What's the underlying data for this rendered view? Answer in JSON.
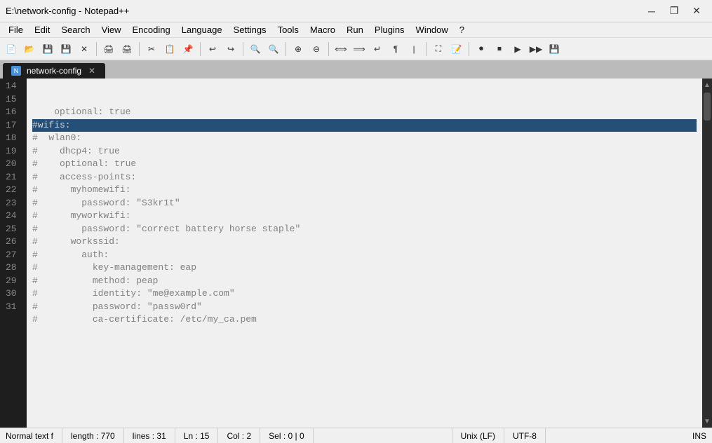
{
  "titleBar": {
    "title": "E:\\network-config - Notepad++",
    "minimizeLabel": "─",
    "restoreLabel": "❐",
    "closeLabel": "✕"
  },
  "menuBar": {
    "items": [
      "File",
      "Edit",
      "Search",
      "View",
      "Encoding",
      "Language",
      "Settings",
      "Tools",
      "Macro",
      "Run",
      "Plugins",
      "Window",
      "?"
    ]
  },
  "tab": {
    "name": "network-config",
    "closeLabel": "✕"
  },
  "codeLines": [
    {
      "num": "14",
      "text": "    optional: true",
      "selected": false
    },
    {
      "num": "15",
      "text": "#wifis:",
      "selected": true
    },
    {
      "num": "16",
      "text": "#  wlan0:",
      "selected": false
    },
    {
      "num": "17",
      "text": "#    dhcp4: true",
      "selected": false
    },
    {
      "num": "18",
      "text": "#    optional: true",
      "selected": false
    },
    {
      "num": "19",
      "text": "#    access-points:",
      "selected": false
    },
    {
      "num": "20",
      "text": "#      myhomewifi:",
      "selected": false
    },
    {
      "num": "21",
      "text": "#        password: \"S3kr1t\"",
      "selected": false
    },
    {
      "num": "22",
      "text": "#      myworkwifi:",
      "selected": false
    },
    {
      "num": "23",
      "text": "#        password: \"correct battery horse staple\"",
      "selected": false
    },
    {
      "num": "24",
      "text": "#      workssid:",
      "selected": false
    },
    {
      "num": "25",
      "text": "#        auth:",
      "selected": false
    },
    {
      "num": "26",
      "text": "#          key-management: eap",
      "selected": false
    },
    {
      "num": "27",
      "text": "#          method: peap",
      "selected": false
    },
    {
      "num": "28",
      "text": "#          identity: \"me@example.com\"",
      "selected": false
    },
    {
      "num": "29",
      "text": "#          password: \"passw0rd\"",
      "selected": false
    },
    {
      "num": "30",
      "text": "#          ca-certificate: /etc/my_ca.pem",
      "selected": false
    },
    {
      "num": "31",
      "text": "",
      "selected": false
    }
  ],
  "statusBar": {
    "mode": "Normal text f",
    "length": "length : 770",
    "lines": "lines : 31",
    "ln": "Ln : 15",
    "col": "Col : 2",
    "sel": "Sel : 0 | 0",
    "lineEnding": "Unix (LF)",
    "encoding": "UTF-8",
    "insertMode": "INS"
  },
  "toolbar": {
    "buttons": [
      {
        "name": "new",
        "icon": "📄"
      },
      {
        "name": "open",
        "icon": "📂"
      },
      {
        "name": "save",
        "icon": "💾"
      },
      {
        "name": "save-all",
        "icon": "💾"
      },
      {
        "name": "close",
        "icon": "✕"
      },
      {
        "name": "print",
        "icon": "🖨"
      },
      {
        "name": "cut",
        "icon": "✂"
      },
      {
        "name": "copy",
        "icon": "📋"
      },
      {
        "name": "paste",
        "icon": "📌"
      },
      {
        "name": "undo",
        "icon": "↩"
      },
      {
        "name": "redo",
        "icon": "↪"
      },
      {
        "name": "find",
        "icon": "🔍"
      },
      {
        "name": "replace",
        "icon": "⇄"
      },
      {
        "name": "zoom-in",
        "icon": "+"
      },
      {
        "name": "zoom-out",
        "icon": "-"
      },
      {
        "name": "wrap",
        "icon": "↵"
      },
      {
        "name": "indent",
        "icon": "→"
      },
      {
        "name": "outdent",
        "icon": "←"
      },
      {
        "name": "bookmark",
        "icon": "★"
      },
      {
        "name": "macro",
        "icon": "⏺"
      },
      {
        "name": "play",
        "icon": "▶"
      },
      {
        "name": "stop",
        "icon": "⏹"
      }
    ]
  }
}
